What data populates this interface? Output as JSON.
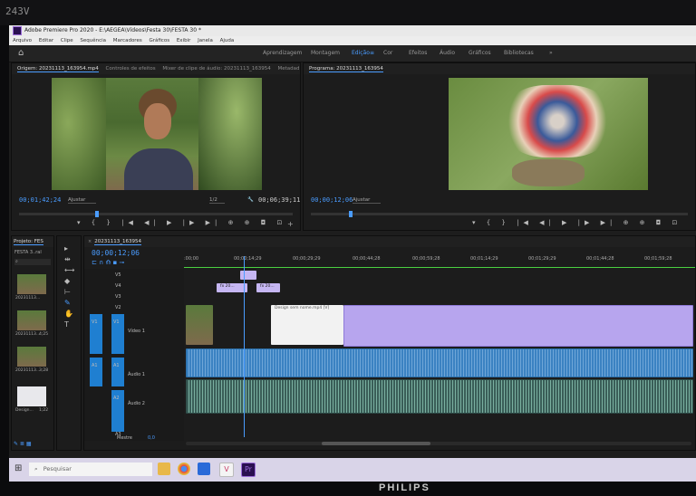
{
  "bezel": {
    "number": "243V",
    "brand": "PHILIPS"
  },
  "window": {
    "title": "Adobe Premiere Pro 2020 - E:\\AEGEA\\Vídeos\\Festa 30\\FESTA 30 *"
  },
  "menu": [
    "Arquivo",
    "Editar",
    "Clipe",
    "Sequência",
    "Marcadores",
    "Gráficos",
    "Exibir",
    "Janela",
    "Ajuda"
  ],
  "workspaces": {
    "items": [
      "Aprendizagem",
      "Montagem",
      "Edição",
      "Cor",
      "Efeitos",
      "Áudio",
      "Gráficos",
      "Bibliotecas"
    ],
    "active": "Edição",
    "more": "»"
  },
  "source": {
    "tabs": [
      "Origem: 20231113_163954.mp4",
      "Controles de efeitos",
      "Mixer de clipe de áudio: 20231113_163954",
      "Metadad"
    ],
    "timecode": "00;01;42;24",
    "fit": "Ajustar",
    "scale": "1/2",
    "duration": "00;06;39;11"
  },
  "program": {
    "tab": "Programa: 20231113_163954",
    "timecode": "00;00;12;06",
    "fit": "Ajustar"
  },
  "project": {
    "tab": "Projeto: FES",
    "bin": "FESTA 3..ral",
    "items": [
      {
        "label": "20231113...",
        "duration": ""
      },
      {
        "label": "20231113...",
        "duration": "4;25"
      },
      {
        "label": "20231113...",
        "duration": "3;28"
      },
      {
        "label": "Design...",
        "duration": "1;22"
      }
    ]
  },
  "timeline": {
    "tab": "20231113_163954",
    "timecode": "00;00;12;06",
    "ruler": [
      ":00;00",
      "00;00;14;29",
      "00;00;29;29",
      "00;00;44;28",
      "00;00;59;28",
      "00;01;14;29",
      "00;01;29;29",
      "00;01;44;28",
      "00;01;59;28"
    ],
    "video_tracks": [
      "V5",
      "V4",
      "V3",
      "V2",
      "V1"
    ],
    "video1_name": "Vídeo 1",
    "audio_tracks": [
      "A1",
      "A2",
      "A3"
    ],
    "audio1_name": "Áudio 1",
    "audio2_name": "Áudio 2",
    "master": {
      "label": "Mestre",
      "value": "0,0"
    },
    "clips": {
      "v5": "",
      "v4a": "fx 20...",
      "v4b": "fx 20...",
      "v1": "Design sem nome.mp4 [V]"
    }
  },
  "taskbar": {
    "search_placeholder": "Pesquisar"
  },
  "colors": {
    "accent": "#4a9cff",
    "video_clip": "#b7a5ee",
    "audio_clip": "#3b82c2",
    "track_target": "#1f7fd1"
  }
}
